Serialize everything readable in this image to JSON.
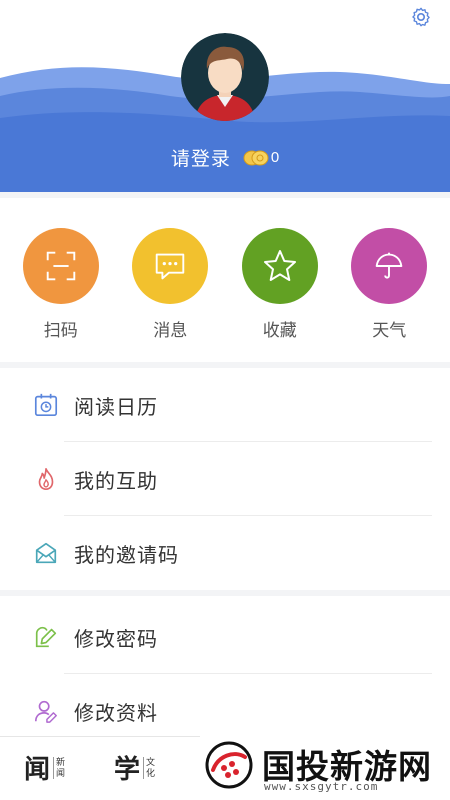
{
  "header": {
    "login_label": "请登录",
    "coin_count": "0",
    "icons": {
      "settings": "gear-icon",
      "coin": "coin-icon",
      "avatar": "user-avatar"
    }
  },
  "quick_actions": [
    {
      "label": "扫码",
      "icon": "scan-icon",
      "color": "#f0963f"
    },
    {
      "label": "消息",
      "icon": "message-icon",
      "color": "#f2c12e"
    },
    {
      "label": "收藏",
      "icon": "star-icon",
      "color": "#62a123"
    },
    {
      "label": "天气",
      "icon": "umbrella-icon",
      "color": "#c24ea6"
    }
  ],
  "menu_group_1": [
    {
      "label": "阅读日历",
      "icon": "calendar-icon"
    },
    {
      "label": "我的互助",
      "icon": "flame-icon"
    },
    {
      "label": "我的邀请码",
      "icon": "envelope-icon"
    }
  ],
  "menu_group_2": [
    {
      "label": "修改密码",
      "icon": "edit-lock-icon"
    },
    {
      "label": "修改资料",
      "icon": "edit-profile-icon"
    }
  ],
  "tabbar": {
    "tabs": [
      {
        "big": "闻",
        "small_top": "新",
        "small_bottom": "闻"
      },
      {
        "big": "学",
        "small_top": "文",
        "small_bottom": "化"
      }
    ]
  },
  "watermark": {
    "title": "国投新游网",
    "url": "www.sxsgytr.com"
  },
  "colors": {
    "header_blue": "#4a78d6",
    "header_wave_light": "#6a93e3"
  }
}
